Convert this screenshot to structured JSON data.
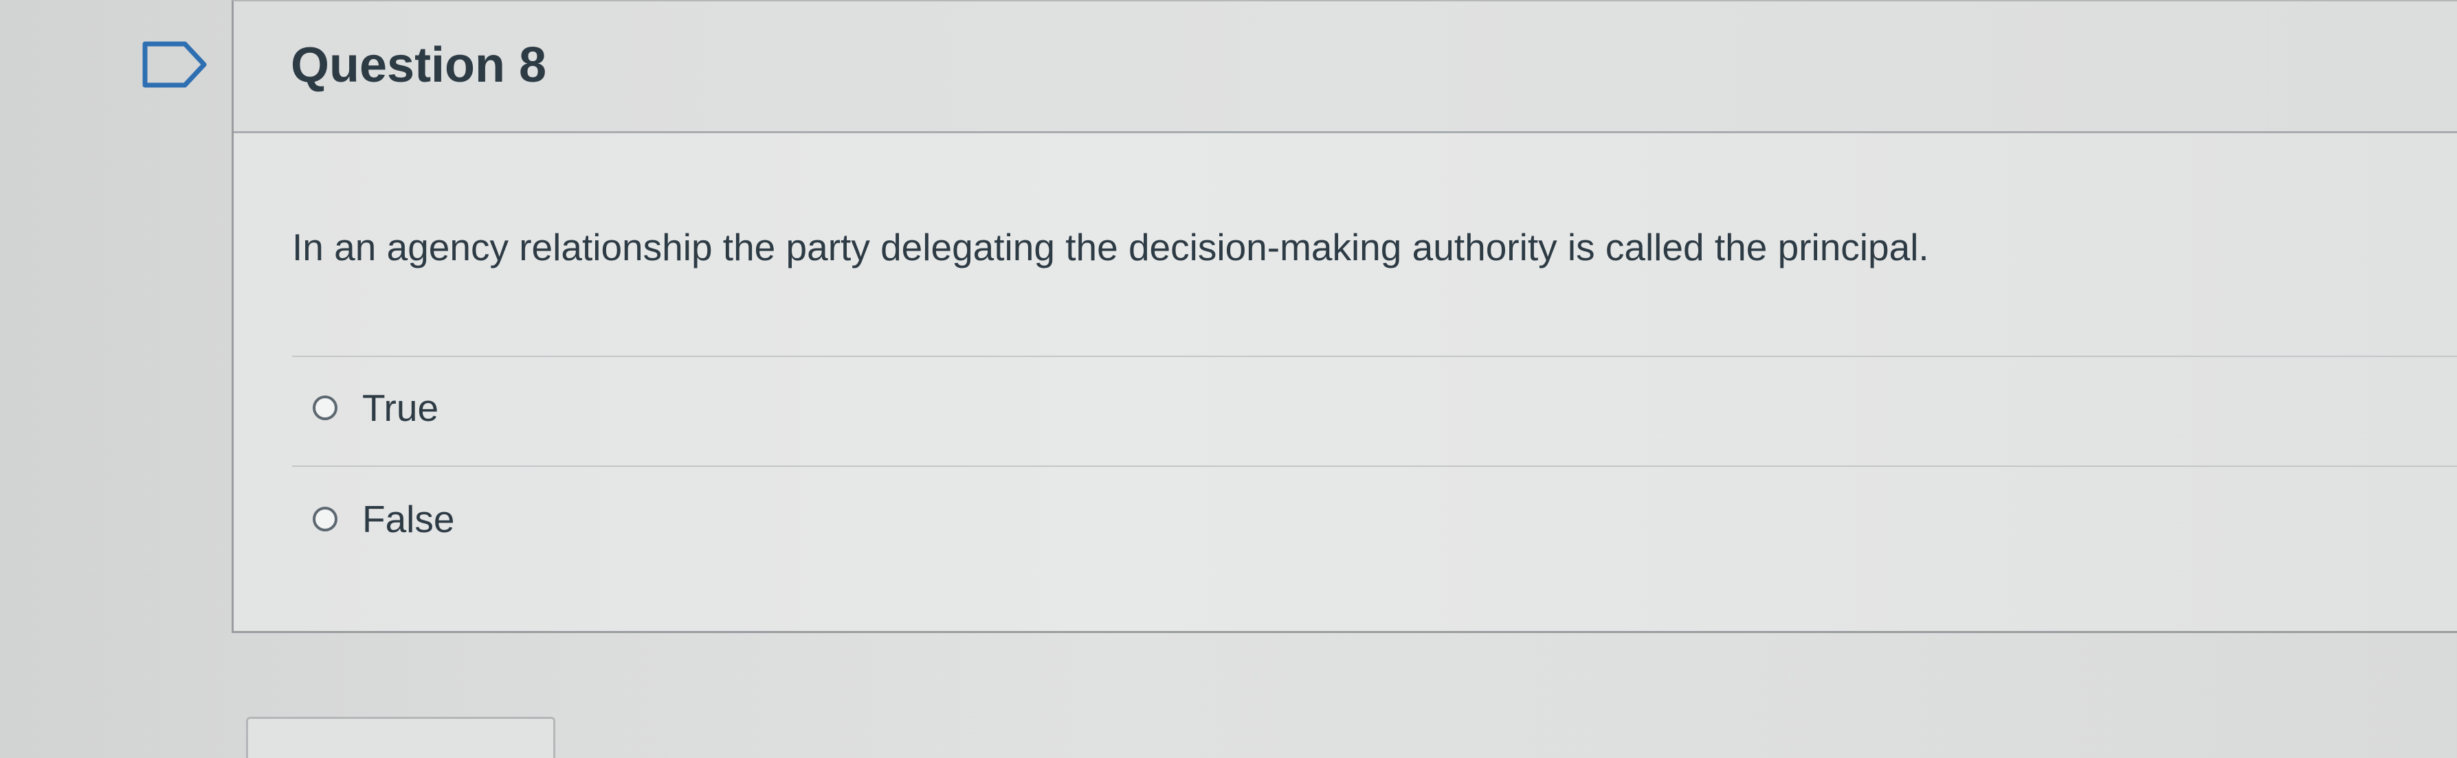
{
  "question": {
    "title": "Question 8",
    "text": "In an agency relationship the party delegating the decision-making authority is called the principal.",
    "flag_icon": "flag-outline-icon",
    "answers": [
      {
        "label": "True",
        "selected": false
      },
      {
        "label": "False",
        "selected": false
      }
    ]
  },
  "colors": {
    "text": "#2d3b45",
    "border": "#9a9d9f",
    "flag": "#2e6fb2"
  }
}
